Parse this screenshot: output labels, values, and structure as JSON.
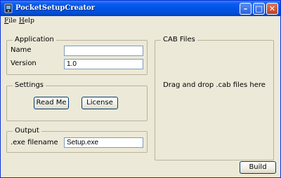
{
  "window": {
    "title": "PocketSetupCreator"
  },
  "menu": {
    "items": [
      {
        "underline": "F",
        "rest": "ile"
      },
      {
        "underline": "H",
        "rest": "elp"
      }
    ]
  },
  "application": {
    "legend": "Application",
    "name_label": "Name",
    "name_value": "",
    "version_label": "Version",
    "version_value": "1.0"
  },
  "settings": {
    "legend": "Settings",
    "readme_label": "Read Me",
    "license_label": "License"
  },
  "output": {
    "legend": "Output",
    "filename_label": ".exe filename",
    "filename_value": "Setup.exe"
  },
  "cab": {
    "legend": "CAB Files",
    "drop_hint": "Drag and drop .cab files here"
  },
  "build_label": "Build",
  "colors": {
    "titlebar": "#0054e3",
    "close": "#c3401f",
    "face": "#ece9d8"
  },
  "icons": [
    "app-icon",
    "minimize-icon",
    "maximize-icon",
    "close-icon"
  ]
}
